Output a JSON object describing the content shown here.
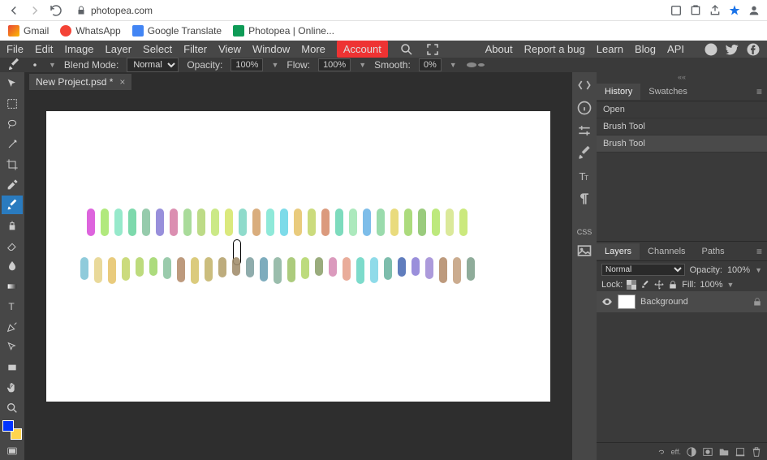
{
  "browser": {
    "url": "photopea.com"
  },
  "bookmarks": {
    "gmail": "Gmail",
    "whatsapp": "WhatsApp",
    "translate": "Google Translate",
    "photopea": "Photopea | Online..."
  },
  "menu": {
    "file": "File",
    "edit": "Edit",
    "image": "Image",
    "layer": "Layer",
    "select": "Select",
    "filter": "Filter",
    "view": "View",
    "window": "Window",
    "more": "More",
    "account": "Account"
  },
  "menuRight": {
    "about": "About",
    "report": "Report a bug",
    "learn": "Learn",
    "blog": "Blog",
    "api": "API"
  },
  "options": {
    "blendLabel": "Blend Mode:",
    "blendValue": "Normal",
    "opacityLabel": "Opacity:",
    "opacityValue": "100%",
    "flowLabel": "Flow:",
    "flowValue": "100%",
    "smoothLabel": "Smooth:",
    "smoothValue": "0%"
  },
  "tab": {
    "name": "New Project.psd *"
  },
  "historyPanel": {
    "tabHistory": "History",
    "tabSwatches": "Swatches",
    "items": [
      "Open",
      "Brush Tool",
      "Brush Tool"
    ]
  },
  "layersPanel": {
    "tabLayers": "Layers",
    "tabChannels": "Channels",
    "tabPaths": "Paths",
    "blend": "Normal",
    "opacityLabel": "Opacity:",
    "opacityValue": "100%",
    "lockLabel": "Lock:",
    "fillLabel": "Fill:",
    "fillValue": "100%",
    "bgLayer": "Background"
  },
  "strokes": {
    "row1": [
      "#d84fd8",
      "#a6e66b",
      "#87e6c4",
      "#6bd4a0",
      "#88c4a0",
      "#8a7fd6",
      "#d67fa6",
      "#9dd68c",
      "#b4d676",
      "#c4e676",
      "#d6e66b",
      "#7fd6c4",
      "#d4a26b",
      "#7fe6d4",
      "#6bd6e6",
      "#e6c46b",
      "#c4d66b",
      "#d68c6b",
      "#6bd6b4",
      "#a0e6b4",
      "#6bb4e6",
      "#8cd6a0",
      "#e6d66b",
      "#a0d66b",
      "#8cc46b",
      "#b4e66b",
      "#d6e68c",
      "#c4e66b"
    ],
    "row2": [
      "#7fc4d6",
      "#e6d48c",
      "#e6c46b",
      "#c4d66b",
      "#b4d66b",
      "#a0d66b",
      "#8cc4a0",
      "#b48c6b",
      "#d6c46b",
      "#c4b46b",
      "#b4a06b",
      "#a08c6b",
      "#7fa0a0",
      "#6ba0b4",
      "#8cb4a0",
      "#a0c46b",
      "#b4d66b",
      "#8ca06b",
      "#d68cb4",
      "#e6a08c",
      "#6bd6c4",
      "#7fd6e6",
      "#6bb4a0",
      "#4a6bb4",
      "#8c7fd6",
      "#a08cd6",
      "#b48c6b",
      "#c4a07f",
      "#7fa08c"
    ]
  }
}
